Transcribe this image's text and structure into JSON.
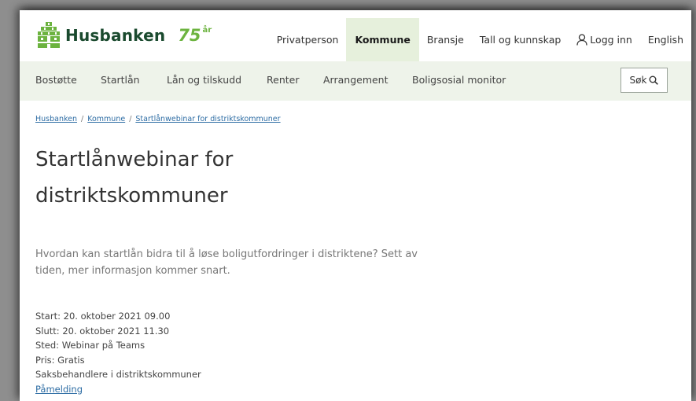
{
  "header": {
    "logo_text": "Husbanken",
    "anniversary_number": "75",
    "anniversary_suffix": "år"
  },
  "top_nav": [
    {
      "label": "Privatperson"
    },
    {
      "label": "Kommune",
      "active": true
    },
    {
      "label": "Bransje"
    },
    {
      "label": "Tall og kunnskap"
    },
    {
      "label": "Logg inn",
      "icon": "user-icon"
    },
    {
      "label": "English"
    }
  ],
  "main_nav": [
    {
      "label": "Bostøtte"
    },
    {
      "label": "Startlån"
    },
    {
      "label": "Lån og tilskudd"
    },
    {
      "label": "Renter"
    },
    {
      "label": "Arrangement"
    },
    {
      "label": "Boligsosial monitor"
    }
  ],
  "search_button": {
    "label": "Søk",
    "icon": "search-icon"
  },
  "breadcrumb": [
    "Husbanken",
    "Kommune",
    "Startlånwebinar for distriktskommuner"
  ],
  "breadcrumb_separator": "/",
  "page": {
    "title_line1": "Startlånwebinar for",
    "title_line2": "distriktskommuner",
    "intro_line1": "Hvordan kan startlån bidra til å løse boligutfordringer i distriktene? Sett av",
    "intro_line2": "tiden, mer informasjon kommer snart.",
    "details": [
      "Start: 20. oktober 2021 09.00",
      "Slutt: 20. oktober 2021 11.30",
      "Sted: Webinar på Teams",
      "Pris: Gratis",
      "Saksbehandlere i distriktskommuner"
    ],
    "signup_link": "Påmelding"
  },
  "colors": {
    "brand_green": "#1a4a2e",
    "accent_green": "#6cb33f",
    "nav_bg": "#eef3ea",
    "active_tab_bg": "#e6f0dc",
    "link": "#2e6da4"
  }
}
